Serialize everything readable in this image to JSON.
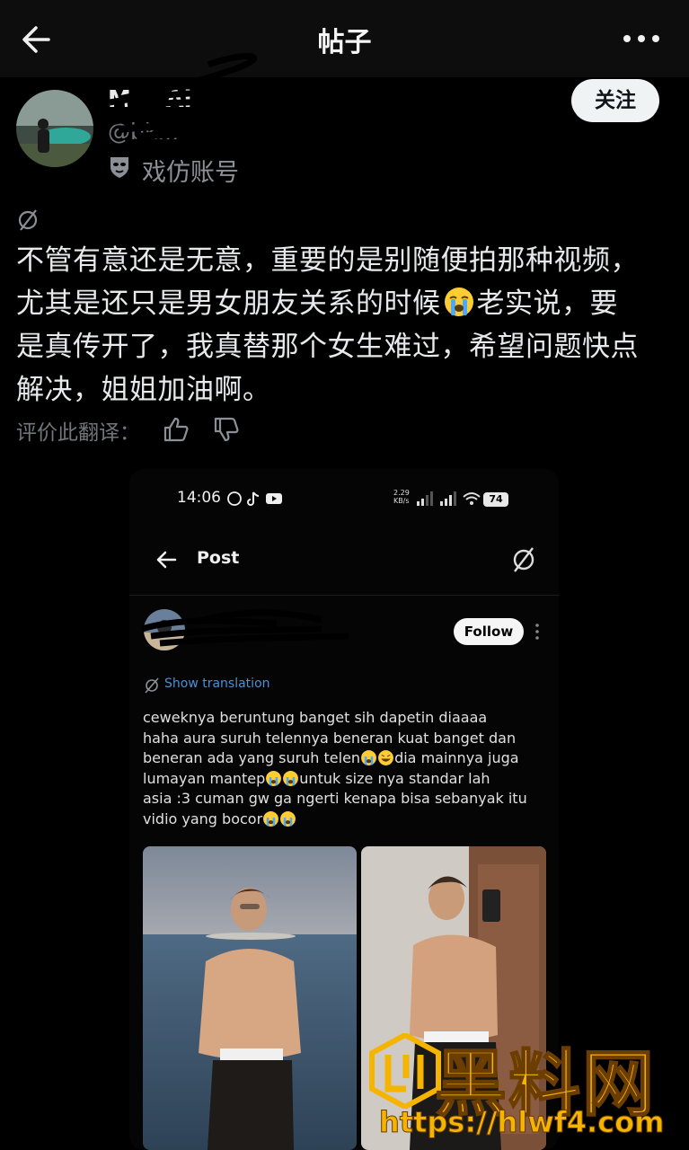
{
  "header": {
    "title": "帖子",
    "back_icon": "arrow-left-icon",
    "more_icon": "more-horizontal-icon"
  },
  "author": {
    "name": "M... Al",
    "handle": "@bk...",
    "parody_label": "戏仿账号",
    "follow_label": "关注"
  },
  "post": {
    "lines": [
      "不管有意还是无意，重要的是别随便拍那种视频，",
      "尤其是还只是男女朋友关系的时候",
      "老实说，要",
      "是真传开了，我真替那个女生难过，希望问题快点",
      "解决，姐姐加油啊。"
    ],
    "rate_label": "评价此翻译："
  },
  "embed": {
    "status": {
      "time": "14:06",
      "net_speed": "2.29",
      "net_unit": "KB/s",
      "battery": "74"
    },
    "nav_title": "Post",
    "follow_label": "Follow",
    "show_translation": "Show translation",
    "text_lines": [
      "ceweknya beruntung banget sih dapetin diaaaa",
      "haha aura suruh telennya beneran kuat banget dan",
      "beneran ada yang suruh telen",
      "dia mainnya juga",
      "lumayan mantep",
      "untuk size nya standar lah",
      "asia :3 cuman gw ga ngerti kenapa bisa sebanyak itu",
      "vidio yang bocor"
    ]
  },
  "watermark": {
    "text": "黑料网",
    "url": "https://hlwf4.com"
  },
  "colors": {
    "background": "#000000",
    "accent_link": "#4a90d9",
    "watermark": "#f5b400"
  }
}
